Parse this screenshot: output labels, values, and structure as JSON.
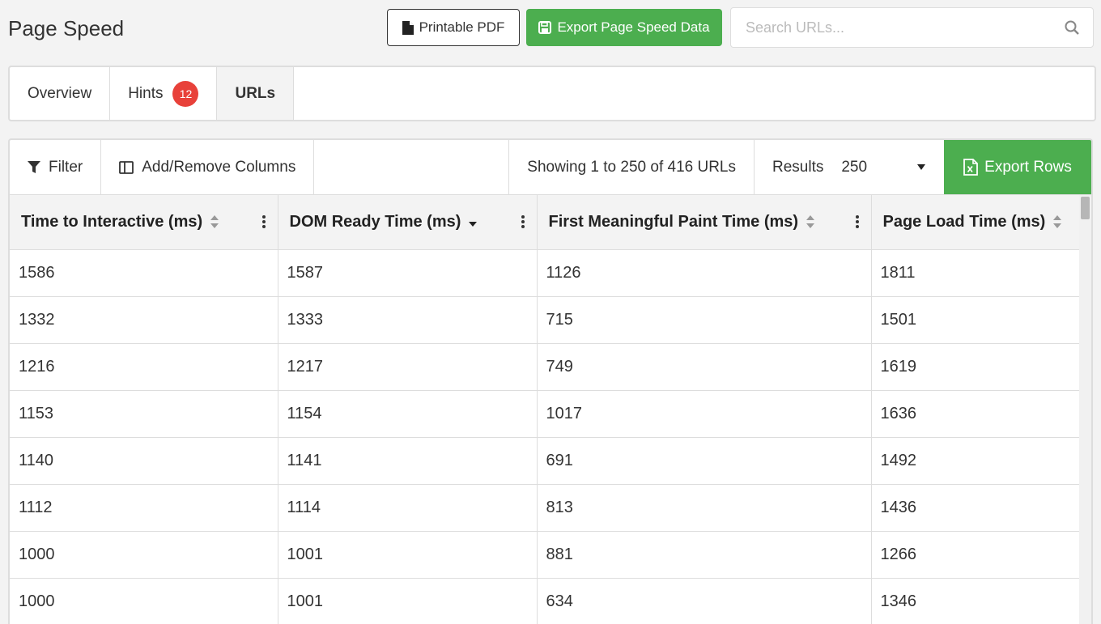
{
  "page": {
    "title": "Page Speed"
  },
  "header": {
    "printable_pdf_label": "Printable PDF",
    "export_label": "Export Page Speed Data",
    "search_placeholder": "Search URLs..."
  },
  "tabs": [
    {
      "label": "Overview"
    },
    {
      "label": "Hints",
      "badge": "12"
    },
    {
      "label": "URLs",
      "active": true
    }
  ],
  "toolbar": {
    "filter_label": "Filter",
    "columns_label": "Add/Remove Columns",
    "showing_text": "Showing 1 to 250 of 416 URLs",
    "results_label": "Results",
    "results_value": "250",
    "export_rows_label": "Export Rows"
  },
  "table": {
    "columns": [
      "Time to Interactive (ms)",
      "DOM Ready Time (ms)",
      "First Meaningful Paint Time (ms)",
      "Page Load Time (ms)"
    ],
    "rows": [
      [
        "1586",
        "1587",
        "1126",
        "1811"
      ],
      [
        "1332",
        "1333",
        "715",
        "1501"
      ],
      [
        "1216",
        "1217",
        "749",
        "1619"
      ],
      [
        "1153",
        "1154",
        "1017",
        "1636"
      ],
      [
        "1140",
        "1141",
        "691",
        "1492"
      ],
      [
        "1112",
        "1114",
        "813",
        "1436"
      ],
      [
        "1000",
        "1001",
        "881",
        "1266"
      ],
      [
        "1000",
        "1001",
        "634",
        "1346"
      ]
    ]
  },
  "colors": {
    "accent_green": "#4cae4f",
    "badge_red": "#e8413a"
  }
}
